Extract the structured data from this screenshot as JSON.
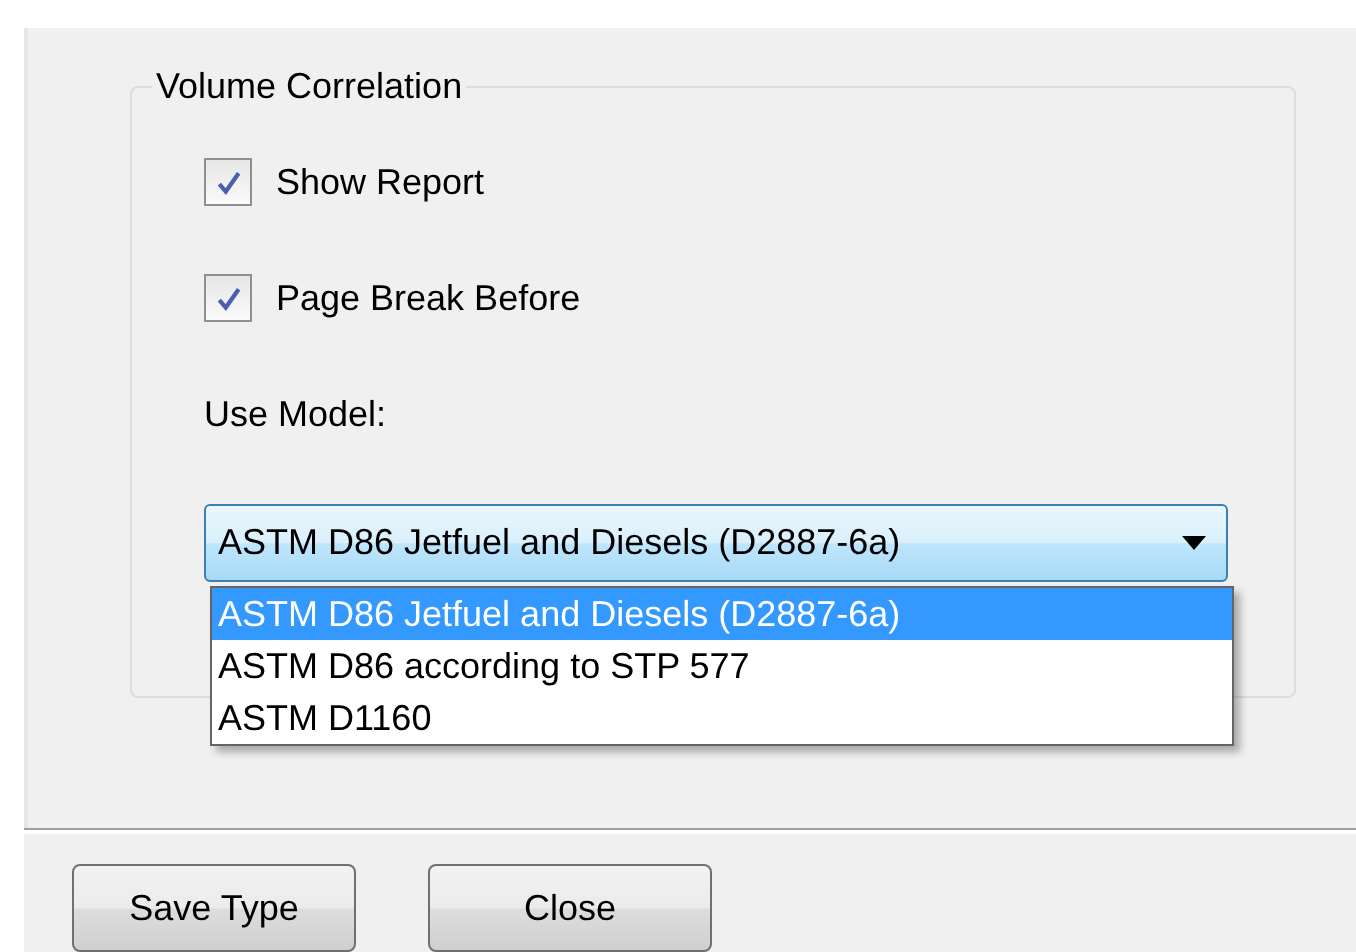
{
  "group": {
    "title": "Volume Correlation",
    "checkboxes": [
      {
        "label": "Show Report",
        "checked": true
      },
      {
        "label": "Page Break Before",
        "checked": true
      }
    ],
    "model_label": "Use Model:",
    "model_combo": {
      "value": "ASTM D86 Jetfuel and Diesels (D2887-6a)",
      "expanded": true,
      "options": [
        {
          "label": "ASTM D86 Jetfuel and Diesels (D2887-6a)",
          "selected": true
        },
        {
          "label": "ASTM D86 according to STP 577",
          "selected": false
        },
        {
          "label": "ASTM D1160",
          "selected": false
        }
      ]
    }
  },
  "buttons": [
    "Save Type",
    "Close"
  ]
}
